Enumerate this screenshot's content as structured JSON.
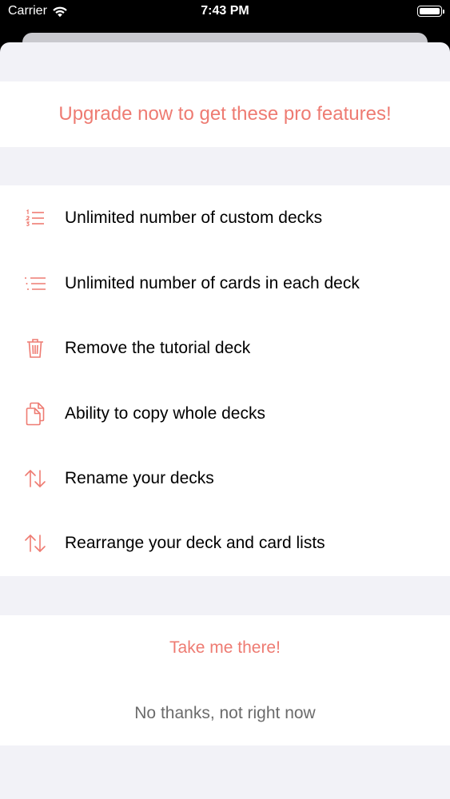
{
  "status_bar": {
    "carrier": "Carrier",
    "time": "7:43 PM"
  },
  "colors": {
    "accent": "#ee7b72",
    "background": "#f2f2f7",
    "secondary_text": "#6b6b6b"
  },
  "header": {
    "title": "Upgrade now to get these pro features!"
  },
  "features": [
    {
      "icon": "numbered-list-icon",
      "label": "Unlimited number of custom decks"
    },
    {
      "icon": "bulleted-list-icon",
      "label": "Unlimited number of cards in each deck"
    },
    {
      "icon": "trash-icon",
      "label": "Remove the tutorial deck"
    },
    {
      "icon": "copy-document-icon",
      "label": "Ability to copy whole decks"
    },
    {
      "icon": "up-down-arrows-icon",
      "label": "Rename your decks"
    },
    {
      "icon": "up-down-arrows-icon",
      "label": "Rearrange your deck and card lists"
    }
  ],
  "actions": {
    "primary_label": "Take me there!",
    "secondary_label": "No thanks, not right now"
  }
}
